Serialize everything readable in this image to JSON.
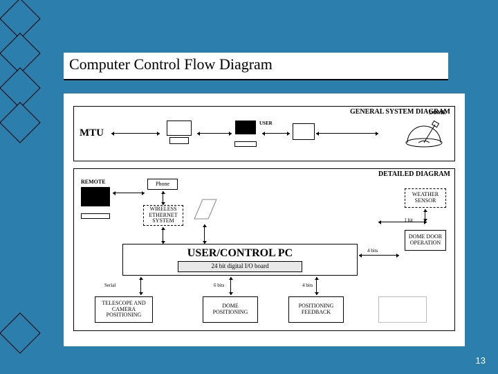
{
  "title": "Computer Control Flow Diagram",
  "page_number": "13",
  "general": {
    "label": "GENERAL SYSTEM DIAGRAM",
    "mtu": "MTU",
    "user": "USER",
    "dome": "DOME"
  },
  "detailed": {
    "label": "DETAILED DIAGRAM",
    "remote": "REMOTE",
    "phone": "Phone",
    "wireless": "WIRELESS ETHERNET SYSTEM",
    "weather": "WEATHER SENSOR",
    "bit1": "1 bit",
    "dome_door": "DOME DOOR OPERATION",
    "user_pc": "USER/CONTROL PC",
    "io_board": "24 bit digital I/O board",
    "serial": "Serial",
    "telescope": "TELESCOPE AND CAMERA POSITIONING",
    "bits6": "6 bits",
    "dome_pos": "DOME POSITIONING",
    "bits4a": "4 bits",
    "bits4b": "4 bits",
    "pos_fb": "POSITIONING FEEDBACK"
  }
}
